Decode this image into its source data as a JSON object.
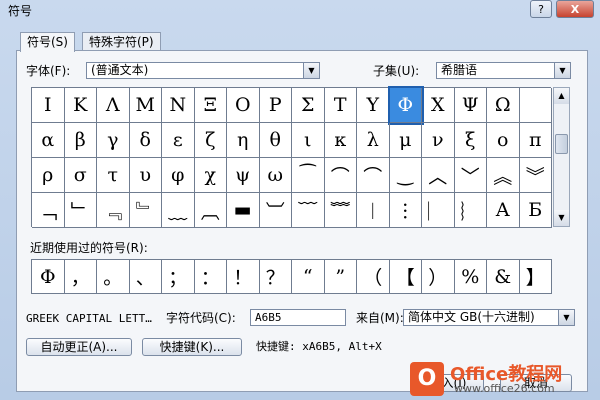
{
  "window": {
    "title": "符号",
    "help_label": "?",
    "close_label": "X"
  },
  "tabs": [
    {
      "label": "符号(S)"
    },
    {
      "label": "特殊字符(P)"
    }
  ],
  "font": {
    "label": "字体(F):",
    "value": "(普通文本)"
  },
  "subset": {
    "label": "子集(U):",
    "value": "希腊语"
  },
  "symbols": [
    "Ι",
    "Κ",
    "Λ",
    "Μ",
    "Ν",
    "Ξ",
    "Ο",
    "Ρ",
    "Σ",
    "Τ",
    "Υ",
    "Φ",
    "Χ",
    "Ψ",
    "Ω",
    "",
    "α",
    "β",
    "γ",
    "δ",
    "ε",
    "ζ",
    "η",
    "θ",
    "ι",
    "κ",
    "λ",
    "μ",
    "ν",
    "ξ",
    "ο",
    "π",
    "ρ",
    "σ",
    "τ",
    "υ",
    "φ",
    "χ",
    "ψ",
    "ω",
    "⁀",
    "⌒",
    "⌒",
    "‿",
    "︿",
    "﹀",
    "︽",
    "︾",
    "﹁",
    "﹂",
    "﹃",
    "﹄",
    "﹏",
    "︹",
    "▬",
    "︺",
    "﹋",
    "﹌",
    "︱",
    "︙",
    "︳",
    "︴",
    "А",
    "Б"
  ],
  "selected_index": 11,
  "recent": {
    "label": "近期使用过的符号(R):",
    "items": [
      "Φ",
      "，",
      "。",
      "、",
      "；",
      "：",
      "！",
      "？",
      "“",
      "”",
      "（",
      "【",
      "）",
      "%",
      "&",
      "】"
    ]
  },
  "char_name": "GREEK CAPITAL LETT…",
  "char_code": {
    "label": "字符代码(C):",
    "value": "A6B5"
  },
  "from": {
    "label": "来自(M):",
    "value": "简体中文 GB(十六进制)"
  },
  "autocorrect_button": "自动更正(A)...",
  "shortcut_button": "快捷键(K)...",
  "shortcut_text": "快捷键: xA6B5, Alt+X",
  "insert_button": "插入(I)",
  "cancel_button": "取消",
  "watermark": {
    "line1": "Office教程网",
    "line2": "www.office26.com",
    "logo": "O"
  }
}
